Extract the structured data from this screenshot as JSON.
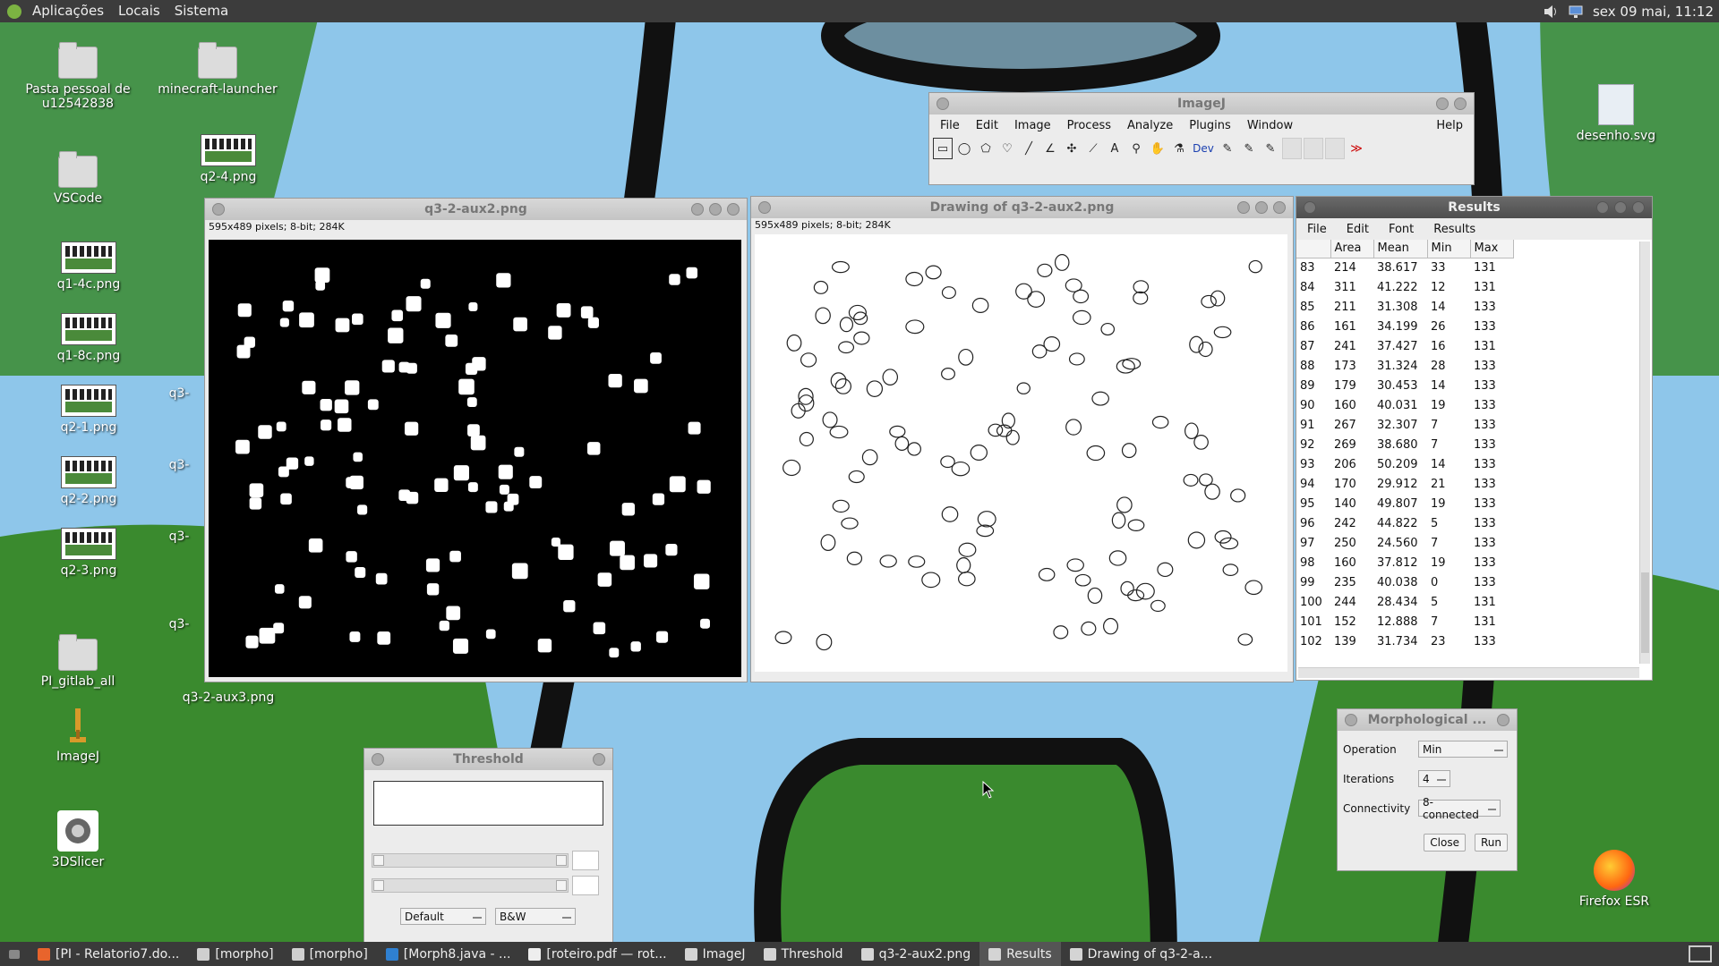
{
  "top_panel": {
    "menus": [
      "Aplicações",
      "Locais",
      "Sistema"
    ],
    "clock": "sex 09 mai, 11:12"
  },
  "desktop_icons": [
    {
      "label": "Pasta pessoal de u12542838",
      "icon": "home-folder-icon"
    },
    {
      "label": "minecraft-launcher",
      "icon": "folder-icon"
    },
    {
      "label": "q2-4.png",
      "icon": "image-thumbnail-icon"
    },
    {
      "label": "VSCode",
      "icon": "folder-icon"
    },
    {
      "label": "q1-4c.png",
      "icon": "image-thumbnail-icon"
    },
    {
      "label": "q1-8c.png",
      "icon": "image-thumbnail-icon"
    },
    {
      "label": "q2-1.png",
      "icon": "image-thumbnail-icon"
    },
    {
      "label": "q2-2.png",
      "icon": "image-thumbnail-icon"
    },
    {
      "label": "q2-3.png",
      "icon": "image-thumbnail-icon"
    },
    {
      "label": "PI_gitlab_all",
      "icon": "folder-icon"
    },
    {
      "label": "q3-2-aux3.png",
      "icon": "image-thumbnail-icon"
    },
    {
      "label": "ImageJ",
      "icon": "microscope-icon"
    },
    {
      "label": "3DSlicer",
      "icon": "slicer-icon"
    },
    {
      "label": "desenho.svg",
      "icon": "svg-file-icon"
    },
    {
      "label": "Firefox ESR",
      "icon": "firefox-icon"
    }
  ],
  "partial_labels": [
    "q3-",
    "q3-",
    "q3-",
    "q3-"
  ],
  "imagej": {
    "title": "ImageJ",
    "menus": [
      "File",
      "Edit",
      "Image",
      "Process",
      "Analyze",
      "Plugins",
      "Window"
    ],
    "help": "Help",
    "tools": [
      {
        "name": "rectangle-tool",
        "glyph": "▭"
      },
      {
        "name": "oval-tool",
        "glyph": "◯"
      },
      {
        "name": "polygon-tool",
        "glyph": "⬠"
      },
      {
        "name": "freehand-tool",
        "glyph": "♡"
      },
      {
        "name": "line-tool",
        "glyph": "╱"
      },
      {
        "name": "angle-tool",
        "glyph": "∠"
      },
      {
        "name": "point-tool",
        "glyph": "✣"
      },
      {
        "name": "wand-tool",
        "glyph": "⟋"
      },
      {
        "name": "text-tool",
        "glyph": "A"
      },
      {
        "name": "zoom-tool",
        "glyph": "⚲"
      },
      {
        "name": "hand-tool",
        "glyph": "✋"
      },
      {
        "name": "dropper-tool",
        "glyph": "⚗"
      }
    ],
    "dev_label": "Dev",
    "more_glyph": "≫"
  },
  "image_window": {
    "title": "q3-2-aux2.png",
    "info": "595x489 pixels; 8-bit; 284K"
  },
  "drawing_window": {
    "title": "Drawing of q3-2-aux2.png",
    "info": "595x489 pixels; 8-bit; 284K"
  },
  "results": {
    "title": "Results",
    "menus": [
      "File",
      "Edit",
      "Font",
      "Results"
    ],
    "columns": [
      "",
      "Area",
      "Mean",
      "Min",
      "Max"
    ],
    "rows": [
      [
        "83",
        "214",
        "38.617",
        "33",
        "131"
      ],
      [
        "84",
        "311",
        "41.222",
        "12",
        "131"
      ],
      [
        "85",
        "211",
        "31.308",
        "14",
        "133"
      ],
      [
        "86",
        "161",
        "34.199",
        "26",
        "133"
      ],
      [
        "87",
        "241",
        "37.427",
        "16",
        "131"
      ],
      [
        "88",
        "173",
        "31.324",
        "28",
        "133"
      ],
      [
        "89",
        "179",
        "30.453",
        "14",
        "133"
      ],
      [
        "90",
        "160",
        "40.031",
        "19",
        "133"
      ],
      [
        "91",
        "267",
        "32.307",
        "7",
        "133"
      ],
      [
        "92",
        "269",
        "38.680",
        "7",
        "133"
      ],
      [
        "93",
        "206",
        "50.209",
        "14",
        "133"
      ],
      [
        "94",
        "170",
        "29.912",
        "21",
        "133"
      ],
      [
        "95",
        "140",
        "49.807",
        "19",
        "133"
      ],
      [
        "96",
        "242",
        "44.822",
        "5",
        "133"
      ],
      [
        "97",
        "250",
        "24.560",
        "7",
        "133"
      ],
      [
        "98",
        "160",
        "37.812",
        "19",
        "133"
      ],
      [
        "99",
        "235",
        "40.038",
        "0",
        "133"
      ],
      [
        "100",
        "244",
        "28.434",
        "5",
        "131"
      ],
      [
        "101",
        "152",
        "12.888",
        "7",
        "131"
      ],
      [
        "102",
        "139",
        "31.734",
        "23",
        "133"
      ]
    ]
  },
  "morph": {
    "title": "Morphological ...",
    "operation_label": "Operation",
    "operation_value": "Min",
    "iterations_label": "Iterations",
    "iterations_value": "4",
    "connectivity_label": "Connectivity",
    "connectivity_value": "8-connected",
    "close": "Close",
    "run": "Run"
  },
  "threshold": {
    "title": "Threshold",
    "method": "Default",
    "mode": "B&W"
  },
  "taskbar": [
    {
      "label": "[PI - Relatorio7.do...",
      "icon": "firefox-icon",
      "color": "#e8642c"
    },
    {
      "label": "[morpho]",
      "icon": "folder-icon",
      "color": "#cfcfcf"
    },
    {
      "label": "[morpho]",
      "icon": "folder-icon",
      "color": "#cfcfcf"
    },
    {
      "label": "[Morph8.java - ...",
      "icon": "vscode-icon",
      "color": "#2f80d1"
    },
    {
      "label": "[roteiro.pdf — rot...",
      "icon": "pdf-icon",
      "color": "#eeeeee"
    },
    {
      "label": "ImageJ",
      "icon": "imagej-icon",
      "color": "#d4d4d4"
    },
    {
      "label": "Threshold",
      "icon": "imagej-icon",
      "color": "#d4d4d4"
    },
    {
      "label": "q3-2-aux2.png",
      "icon": "imagej-icon",
      "color": "#d4d4d4"
    },
    {
      "label": "Results",
      "icon": "imagej-icon",
      "color": "#d4d4d4",
      "active": true
    },
    {
      "label": "Drawing of q3-2-a...",
      "icon": "imagej-icon",
      "color": "#d4d4d4"
    }
  ],
  "colors": {
    "sky": "#8ec6ea",
    "grass": "#3a8a2e",
    "panel": "#3c3c3c"
  }
}
